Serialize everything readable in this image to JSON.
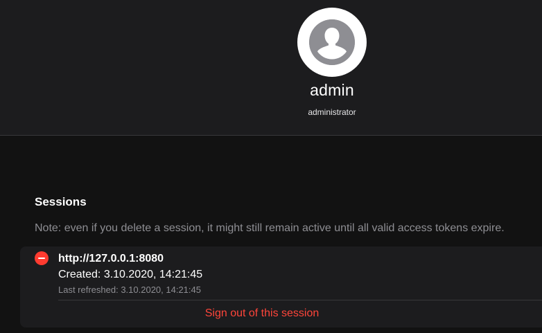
{
  "profile": {
    "username": "admin",
    "role": "administrator",
    "avatar_icon": "user-silhouette-icon"
  },
  "sessions": {
    "title": "Sessions",
    "note": "Note: even if you delete a session, it might still remain active until all valid access tokens expire.",
    "items": [
      {
        "host": "http://127.0.0.1:8080",
        "created": "Created: 3.10.2020, 14:21:45",
        "last_refreshed": "Last refreshed: 3.10.2020, 14:21:45",
        "signout_label": "Sign out of this session",
        "delete_icon": "minus-circle-icon"
      }
    ]
  },
  "colors": {
    "background": "#121212",
    "header_bg": "#1c1c1e",
    "card_bg": "#1c1c1e",
    "destructive": "#ff3b30",
    "destructive_text": "#ff453a",
    "secondary_text": "#8e8e93"
  }
}
